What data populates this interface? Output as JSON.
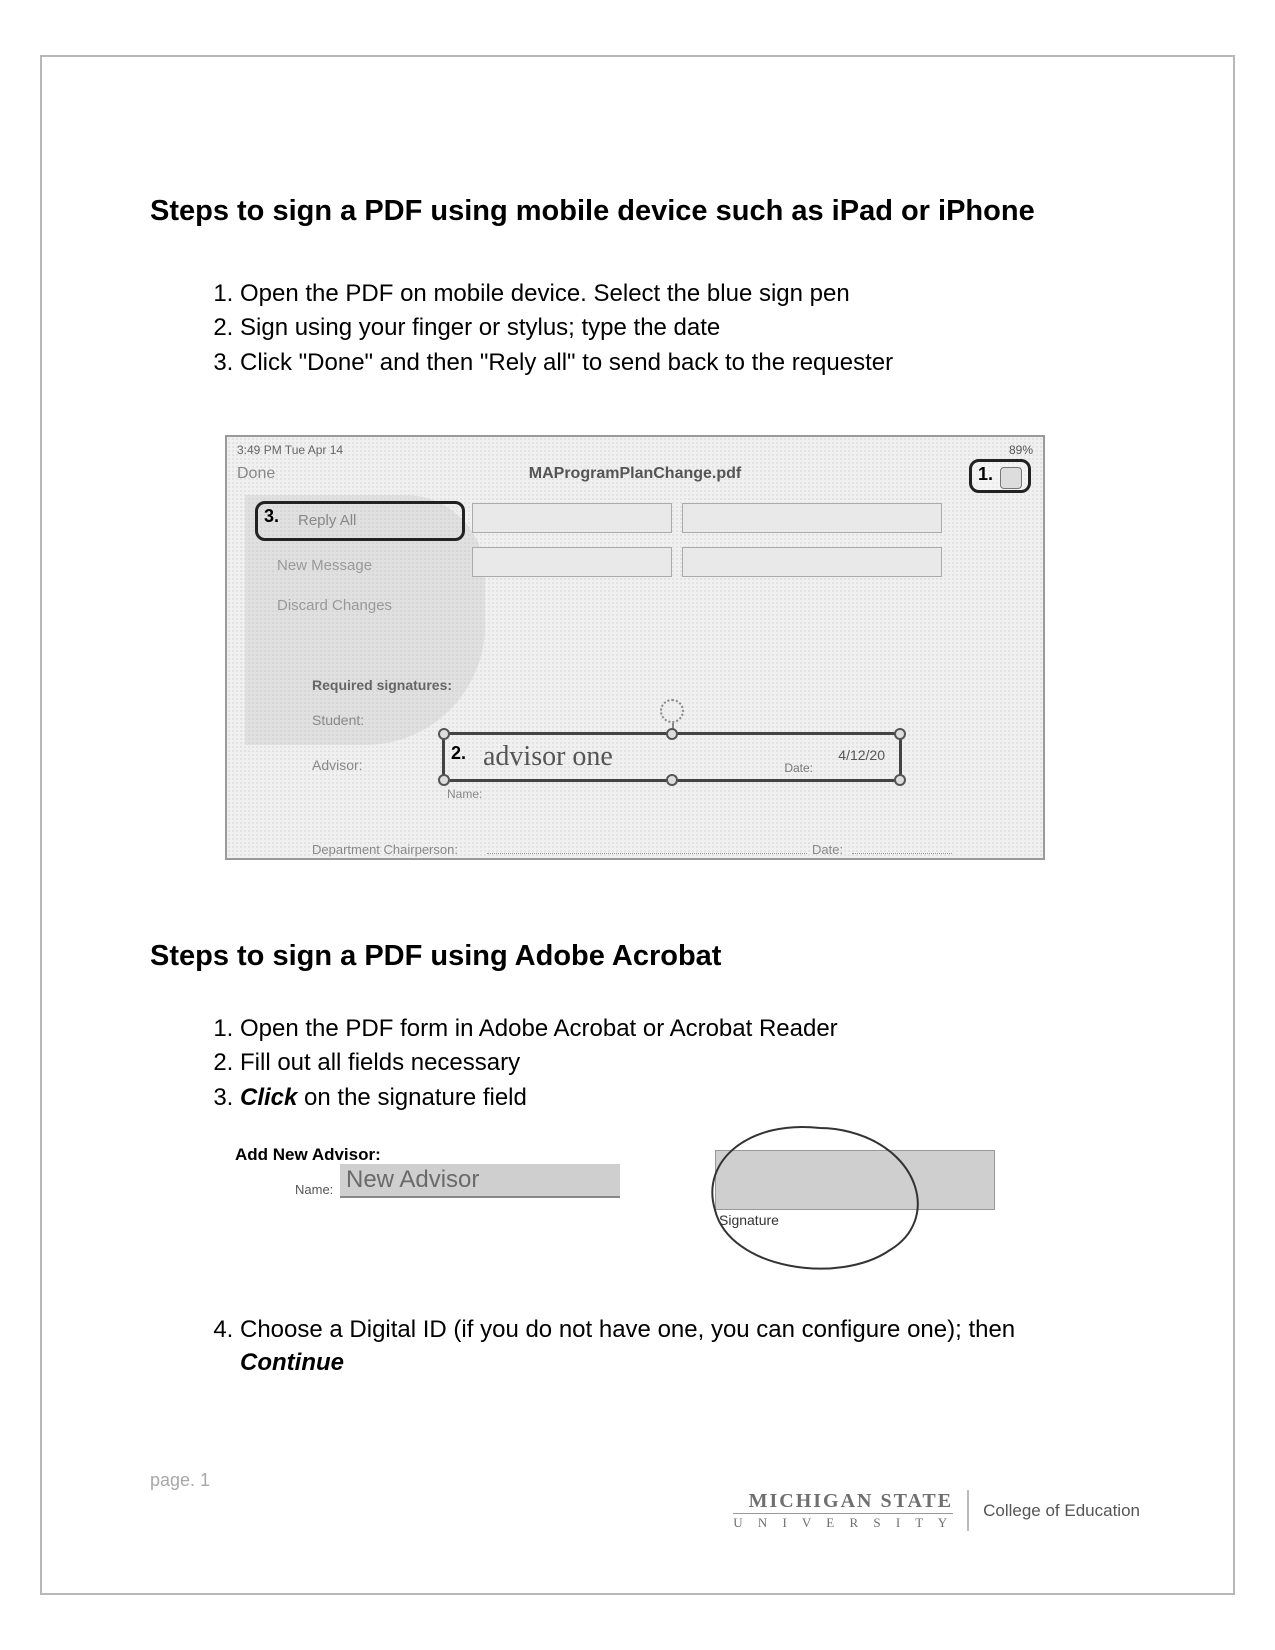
{
  "section1": {
    "title": "Steps to sign a PDF using mobile device such as iPad or iPhone",
    "steps": [
      "Open the PDF on mobile device.  Select the blue sign pen",
      "Sign using your finger or stylus; type the date",
      "Click \"Done\" and then \"Rely all\" to send back to the requester"
    ]
  },
  "screenshot1": {
    "status_time": "3:49 PM  Tue Apr 14",
    "battery": "89%",
    "done": "Done",
    "doc_title": "MAProgramPlanChange.pdf",
    "callout1": "1.",
    "callout3": "3.",
    "reply_all": "Reply All",
    "new_message": "New Message",
    "discard_changes": "Discard Changes",
    "required_sigs": "Required signatures:",
    "student": "Student:",
    "advisor": "Advisor:",
    "callout2": "2.",
    "signature_text": "advisor one",
    "date_label": "Date:",
    "date_value": "4/12/20",
    "name_label": "Name:",
    "dept_chair": "Department Chairperson:",
    "dept_date": "Date:"
  },
  "section2": {
    "title": "Steps to sign a PDF using Adobe Acrobat",
    "step1": "Open the PDF form in Adobe Acrobat or Acrobat Reader",
    "step2": "Fill out all fields necessary",
    "step3_prefix": "Click",
    "step3_rest": " on the signature field",
    "step4_main": "Choose a Digital ID (if you do not have one, you can configure one); then ",
    "step4_action": "Continue"
  },
  "screenshot2": {
    "add_label": "Add New Advisor:",
    "name_label": "Name:",
    "name_value": "New Advisor",
    "signature_caption": "Signature"
  },
  "footer": {
    "page": "page. 1",
    "brand_line1": "MICHIGAN STATE",
    "brand_line2": "U N I V E R S I T Y",
    "college": "College of Education"
  }
}
